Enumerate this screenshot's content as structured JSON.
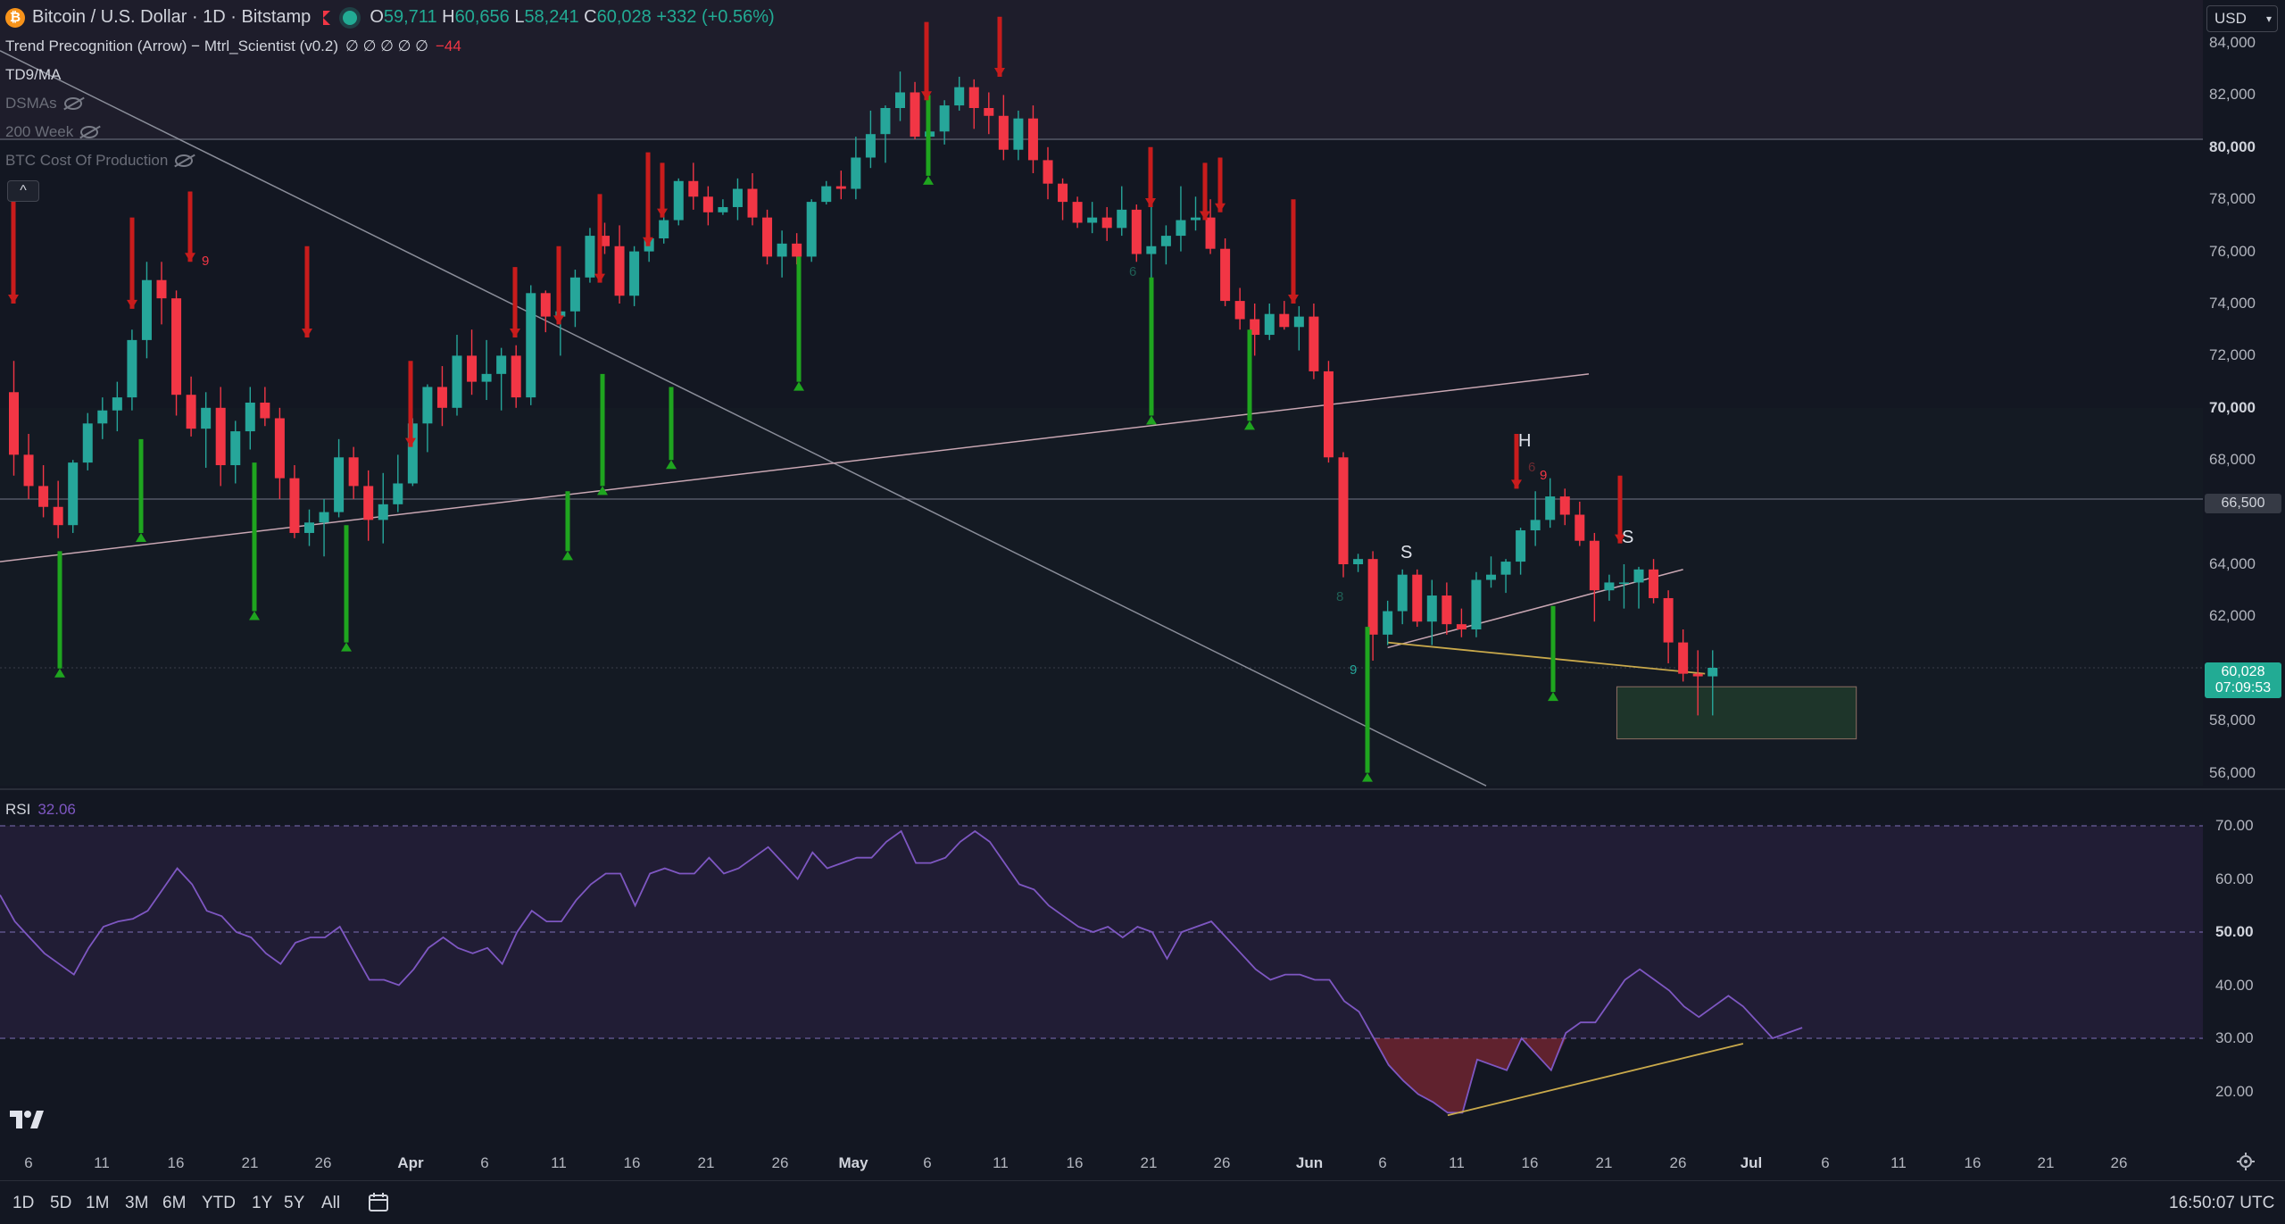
{
  "header": {
    "coin_glyph": "₿",
    "title": "Bitcoin / U.S. Dollar · 1D · Bitstamp",
    "ohlc": {
      "o_label": "O",
      "o": "59,711",
      "h_label": "H",
      "h": "60,656",
      "l_label": "L",
      "l": "58,241",
      "c_label": "C",
      "c": "60,028",
      "change": "+332 (+0.56%)"
    }
  },
  "indicators": {
    "trend_name": "Trend Precognition (Arrow) − Mtrl_Scientist (v0.2)",
    "trend_values": "∅ ∅ ∅ ∅ ∅",
    "trend_value_red": "−44",
    "items": [
      "TD9/MA",
      "DSMAs",
      "200 Week",
      "BTC Cost Of Production"
    ],
    "collapse_glyph": "^"
  },
  "currency": "USD",
  "price_axis": {
    "ticks": [
      "84,000",
      "82,000",
      "80,000",
      "78,000",
      "76,000",
      "74,000",
      "72,000",
      "70,000",
      "68,000",
      "66,500",
      "64,000",
      "62,000",
      "60,028",
      "58,000",
      "56,000"
    ],
    "bold_ticks": [
      "80,000",
      "70,000"
    ],
    "current_price": "60,028",
    "countdown": "07:09:53",
    "level_label": "66,500"
  },
  "rsi": {
    "label": "RSI",
    "value": "32.06",
    "ticks": [
      "70.00",
      "60.00",
      "50.00",
      "40.00",
      "30.00",
      "20.00"
    ]
  },
  "time_axis": {
    "labels": [
      "6",
      "11",
      "16",
      "21",
      "26",
      "Apr",
      "6",
      "11",
      "16",
      "21",
      "26",
      "May",
      "6",
      "11",
      "16",
      "21",
      "26",
      "Jun",
      "6",
      "11",
      "16",
      "21",
      "26",
      "Jul",
      "6",
      "11",
      "16",
      "21",
      "26"
    ],
    "bold": [
      "Apr",
      "May",
      "Jun",
      "Jul"
    ]
  },
  "annotations": {
    "h": "H",
    "s1": "S",
    "s2": "S",
    "td9a": "9",
    "td9b": "9",
    "td9c": "9",
    "td6a": "6",
    "td6b": "6",
    "td8": "8"
  },
  "toolbar": {
    "timeframes": [
      "1D",
      "5D",
      "1M",
      "3M",
      "6M",
      "YTD",
      "1Y",
      "5Y",
      "All"
    ],
    "clock": "16:50:07 UTC"
  },
  "colors": {
    "bg": "#131722",
    "up": "#26a69a",
    "down": "#f23645",
    "rsi_line": "#7e57c2",
    "trend_line": "#e8c4b8",
    "yellow_line": "#c9a94b",
    "green_arrow": "#1fa51f",
    "red_arrow": "#c81c1c"
  },
  "chart_data": {
    "type": "candlestick",
    "symbol": "BTCUSD",
    "interval": "1D",
    "y_range": [
      55500,
      84500
    ],
    "candles": [
      [
        70600,
        71800,
        67400,
        68200
      ],
      [
        68200,
        69000,
        66500,
        67000
      ],
      [
        67000,
        67800,
        65800,
        66200
      ],
      [
        66200,
        67200,
        65000,
        65500
      ],
      [
        65500,
        68000,
        65200,
        67900
      ],
      [
        67900,
        69800,
        67600,
        69400
      ],
      [
        69400,
        70400,
        68800,
        69900
      ],
      [
        69900,
        71000,
        69100,
        70400
      ],
      [
        70400,
        73000,
        69900,
        72600
      ],
      [
        72600,
        75600,
        71900,
        74900
      ],
      [
        74900,
        75600,
        73200,
        74200
      ],
      [
        74200,
        74500,
        69700,
        70500
      ],
      [
        70500,
        71200,
        68900,
        69200
      ],
      [
        69200,
        70600,
        67700,
        70000
      ],
      [
        70000,
        70800,
        67000,
        67800
      ],
      [
        67800,
        69500,
        67100,
        69100
      ],
      [
        69100,
        70800,
        68400,
        70200
      ],
      [
        70200,
        70800,
        69300,
        69600
      ],
      [
        69600,
        70000,
        66500,
        67300
      ],
      [
        67300,
        67800,
        65000,
        65200
      ],
      [
        65200,
        66100,
        64700,
        65600
      ],
      [
        65600,
        66500,
        64300,
        66000
      ],
      [
        66000,
        68800,
        65800,
        68100
      ],
      [
        68100,
        68500,
        66500,
        67000
      ],
      [
        67000,
        67600,
        64900,
        65700
      ],
      [
        65700,
        67500,
        64800,
        66300
      ],
      [
        66300,
        68200,
        66000,
        67100
      ],
      [
        67100,
        69600,
        67000,
        69400
      ],
      [
        69400,
        70900,
        68300,
        70800
      ],
      [
        70800,
        71600,
        69300,
        70000
      ],
      [
        70000,
        72800,
        69700,
        72000
      ],
      [
        72000,
        73000,
        70500,
        71000
      ],
      [
        71000,
        72600,
        70300,
        71300
      ],
      [
        71300,
        72300,
        69900,
        72000
      ],
      [
        72000,
        72400,
        70000,
        70400
      ],
      [
        70400,
        74700,
        70100,
        74400
      ],
      [
        74400,
        74500,
        72900,
        73500
      ],
      [
        73500,
        74400,
        72000,
        73700
      ],
      [
        73700,
        75300,
        73100,
        75000
      ],
      [
        75000,
        76900,
        74800,
        76600
      ],
      [
        76600,
        77100,
        75900,
        76200
      ],
      [
        76200,
        77000,
        74000,
        74300
      ],
      [
        74300,
        76200,
        73900,
        76000
      ],
      [
        76000,
        76600,
        75600,
        76500
      ],
      [
        76500,
        77600,
        76300,
        77200
      ],
      [
        77200,
        78800,
        77000,
        78700
      ],
      [
        78700,
        79400,
        77600,
        78100
      ],
      [
        78100,
        78500,
        77000,
        77500
      ],
      [
        77500,
        78000,
        77400,
        77700
      ],
      [
        77700,
        78800,
        77200,
        78400
      ],
      [
        78400,
        79000,
        77000,
        77300
      ],
      [
        77300,
        77600,
        75500,
        75800
      ],
      [
        75800,
        76800,
        75000,
        76300
      ],
      [
        76300,
        76700,
        75500,
        75800
      ],
      [
        75800,
        78000,
        75600,
        77900
      ],
      [
        77900,
        78700,
        77800,
        78500
      ],
      [
        78500,
        79100,
        78000,
        78400
      ],
      [
        78400,
        80400,
        78000,
        79600
      ],
      [
        79600,
        81400,
        79200,
        80500
      ],
      [
        80500,
        81600,
        79400,
        81500
      ],
      [
        81500,
        82900,
        81000,
        82100
      ],
      [
        82100,
        82500,
        80300,
        80400
      ],
      [
        80400,
        81000,
        80100,
        80600
      ],
      [
        80600,
        81800,
        80100,
        81600
      ],
      [
        81600,
        82700,
        81400,
        82300
      ],
      [
        82300,
        82600,
        80700,
        81500
      ],
      [
        81500,
        82100,
        80500,
        81200
      ],
      [
        81200,
        82000,
        79500,
        79900
      ],
      [
        79900,
        81400,
        79500,
        81100
      ],
      [
        81100,
        81600,
        79000,
        79500
      ],
      [
        79500,
        80000,
        78000,
        78600
      ],
      [
        78600,
        78800,
        77200,
        77900
      ],
      [
        77900,
        78100,
        76900,
        77100
      ],
      [
        77100,
        77900,
        76700,
        77300
      ],
      [
        77300,
        77700,
        76400,
        76900
      ],
      [
        76900,
        78500,
        76600,
        77600
      ],
      [
        77600,
        77800,
        75600,
        75900
      ],
      [
        75900,
        78700,
        74300,
        76200
      ],
      [
        76200,
        77000,
        75500,
        76600
      ],
      [
        76600,
        78500,
        76000,
        77200
      ],
      [
        77200,
        78100,
        76800,
        77300
      ],
      [
        77300,
        78000,
        75900,
        76100
      ],
      [
        76100,
        76500,
        73900,
        74100
      ],
      [
        74100,
        74600,
        73000,
        73400
      ],
      [
        73400,
        74000,
        72000,
        72800
      ],
      [
        72800,
        74000,
        72600,
        73600
      ],
      [
        73600,
        74100,
        73000,
        73100
      ],
      [
        73100,
        73900,
        72200,
        73500
      ],
      [
        73500,
        74000,
        71100,
        71400
      ],
      [
        71400,
        71800,
        67900,
        68100
      ],
      [
        68100,
        68300,
        63500,
        64000
      ],
      [
        64000,
        64400,
        63700,
        64200
      ],
      [
        64200,
        64500,
        60300,
        61300
      ],
      [
        61300,
        62600,
        60900,
        62200
      ],
      [
        62200,
        63800,
        61700,
        63600
      ],
      [
        63600,
        63800,
        61600,
        61800
      ],
      [
        61800,
        63400,
        60900,
        62800
      ],
      [
        62800,
        63300,
        61300,
        61700
      ],
      [
        61700,
        62300,
        61200,
        61500
      ],
      [
        61500,
        63700,
        61200,
        63400
      ],
      [
        63400,
        64300,
        63100,
        63600
      ],
      [
        63600,
        64200,
        62900,
        64100
      ],
      [
        64100,
        65400,
        63600,
        65300
      ],
      [
        65300,
        66800,
        64700,
        65700
      ],
      [
        65700,
        67300,
        65400,
        66600
      ],
      [
        66600,
        66900,
        65500,
        65900
      ],
      [
        65900,
        66400,
        64700,
        64900
      ],
      [
        64900,
        65200,
        61800,
        63000
      ],
      [
        63000,
        63600,
        62600,
        63300
      ],
      [
        63300,
        64000,
        62300,
        63300
      ],
      [
        63300,
        63900,
        62300,
        63800
      ],
      [
        63800,
        64200,
        62500,
        62700
      ],
      [
        62700,
        63000,
        60200,
        61000
      ],
      [
        61000,
        61500,
        59500,
        59800
      ],
      [
        59800,
        60700,
        58200,
        59700
      ],
      [
        59700,
        60700,
        58200,
        60028
      ]
    ],
    "rsi_values": [
      57,
      52,
      49,
      46,
      44,
      42,
      47,
      51,
      52,
      52.5,
      54,
      58,
      62,
      59,
      54,
      53,
      50,
      49,
      46,
      44,
      48,
      49,
      49,
      51,
      46,
      41,
      41,
      40,
      43,
      47,
      49,
      47,
      46,
      47,
      44,
      50,
      54,
      52,
      52,
      56,
      59,
      61,
      61,
      55,
      61,
      62,
      61,
      61,
      64,
      61,
      62,
      64,
      66,
      63,
      60,
      65,
      62,
      63,
      64,
      64,
      67,
      69,
      63,
      63,
      64,
      67,
      69,
      67,
      63,
      59,
      58,
      55,
      53,
      51,
      50,
      51,
      49,
      51,
      50,
      45,
      50,
      51,
      52,
      49,
      46,
      43,
      41,
      42,
      42,
      41,
      41,
      37,
      35,
      30,
      25,
      22,
      19.5,
      18,
      16,
      16,
      26,
      25,
      24,
      30,
      27,
      24,
      31,
      33,
      33,
      37,
      41,
      43,
      41,
      39,
      36,
      34,
      36,
      38,
      36,
      33,
      30,
      31,
      32
    ]
  }
}
